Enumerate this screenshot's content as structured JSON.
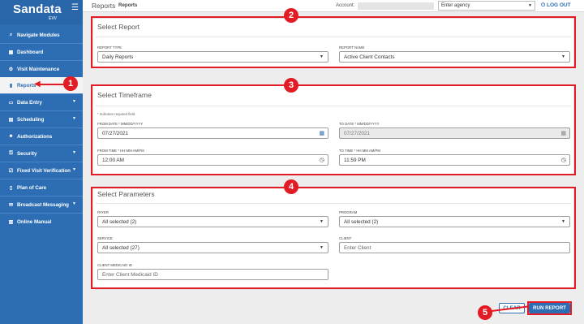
{
  "sidebar": {
    "logo": "Sandata",
    "logo_sub": "EVV",
    "items": [
      {
        "label": "Navigate Modules",
        "icon": "search-icon",
        "glyph": "⌕",
        "caret": false
      },
      {
        "label": "Dashboard",
        "icon": "dashboard-icon",
        "glyph": "▦",
        "caret": false
      },
      {
        "label": "Visit Maintenance",
        "icon": "gears-icon",
        "glyph": "⚙",
        "caret": false
      },
      {
        "label": "Reports",
        "icon": "bar-chart-icon",
        "glyph": "▮",
        "caret": false,
        "active": true
      },
      {
        "label": "Data Entry",
        "icon": "keyboard-icon",
        "glyph": "▭",
        "caret": true
      },
      {
        "label": "Scheduling",
        "icon": "calendar-icon",
        "glyph": "▤",
        "caret": true
      },
      {
        "label": "Authorizations",
        "icon": "users-icon",
        "glyph": "☻",
        "caret": false
      },
      {
        "label": "Security",
        "icon": "lock-icon",
        "glyph": "⚿",
        "caret": true
      },
      {
        "label": "Fixed Visit Verification",
        "icon": "check-square-icon",
        "glyph": "☑",
        "caret": true
      },
      {
        "label": "Plan of Care",
        "icon": "document-icon",
        "glyph": "▯",
        "caret": false
      },
      {
        "label": "Broadcast Messaging",
        "icon": "envelope-icon",
        "glyph": "✉",
        "caret": true
      },
      {
        "label": "Online Manual",
        "icon": "book-icon",
        "glyph": "▥",
        "caret": false
      }
    ]
  },
  "topbar": {
    "crumb_main": "Reports",
    "crumb_sub": "Reports",
    "account_label": "Account:",
    "agency_value": "Enter agency",
    "logout": "LOG OUT"
  },
  "select_report": {
    "title": "Select Report",
    "report_type_label": "REPORT TYPE",
    "report_type_value": "Daily Reports",
    "report_name_label": "REPORT NAME",
    "report_name_value": "Active Client Contacts"
  },
  "timeframe": {
    "title": "Select Timeframe",
    "required_note": "* Indicates required field",
    "from_date_label": "FROM DATE * MM/DD/YYYY",
    "from_date_value": "07/27/2021",
    "to_date_label": "TO DATE * MM/DD/YYYY",
    "to_date_value": "07/27/2021",
    "from_time_label": "FROM TIME * HH:MM AM/PM",
    "from_time_value": "12:00 AM",
    "to_time_label": "TO TIME * HH:MM AM/PM",
    "to_time_value": "11:59 PM"
  },
  "parameters": {
    "title": "Select Parameters",
    "payer_label": "PAYER",
    "payer_value": "All selected (2)",
    "program_label": "PROGRAM",
    "program_value": "All selected (2)",
    "service_label": "SERVICE",
    "service_value": "All selected (27)",
    "client_label": "CLIENT",
    "client_placeholder": "Enter Client",
    "medicaid_label": "CLIENT MEDICAID ID",
    "medicaid_placeholder": "Enter Client Medicaid ID"
  },
  "actions": {
    "clear": "CLEAR",
    "run": "RUN REPORT"
  },
  "annotations": [
    "1",
    "2",
    "3",
    "4",
    "5"
  ],
  "colors": {
    "sidebar": "#2c6db3",
    "annotation": "#e21b24",
    "primary_button": "#2c6db3"
  }
}
